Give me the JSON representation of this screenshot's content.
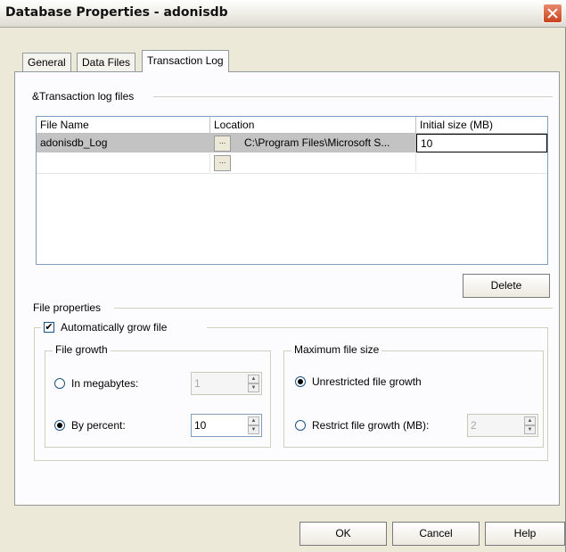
{
  "window": {
    "title": "Database Properties - adonisdb"
  },
  "tabs": [
    {
      "label": "General"
    },
    {
      "label": "Data Files"
    },
    {
      "label": "Transaction Log"
    }
  ],
  "log_files": {
    "group_label": "&Transaction log files",
    "columns": [
      "File Name",
      "Location",
      "Initial size (MB)"
    ],
    "rows": [
      {
        "file_name": "adonisdb_Log",
        "location": "C:\\Program Files\\Microsoft S...",
        "initial_size": "10",
        "browse": "..."
      },
      {
        "file_name": "",
        "location": "",
        "initial_size": "",
        "browse": "..."
      }
    ],
    "delete_label": "Delete"
  },
  "file_properties": {
    "label": "File properties",
    "auto_grow": {
      "label": "Automatically grow file",
      "checked": true
    },
    "growth": {
      "label": "File growth",
      "megabytes": {
        "label": "In megabytes:",
        "value": "1",
        "selected": false
      },
      "percent": {
        "label": "By percent:",
        "value": "10",
        "selected": true
      }
    },
    "max_size": {
      "label": "Maximum file size",
      "unrestricted": {
        "label": "Unrestricted file growth",
        "selected": true
      },
      "restrict": {
        "label": "Restrict file growth (MB):",
        "value": "2",
        "selected": false
      }
    }
  },
  "footer": {
    "ok": "OK",
    "cancel": "Cancel",
    "help": "Help"
  }
}
